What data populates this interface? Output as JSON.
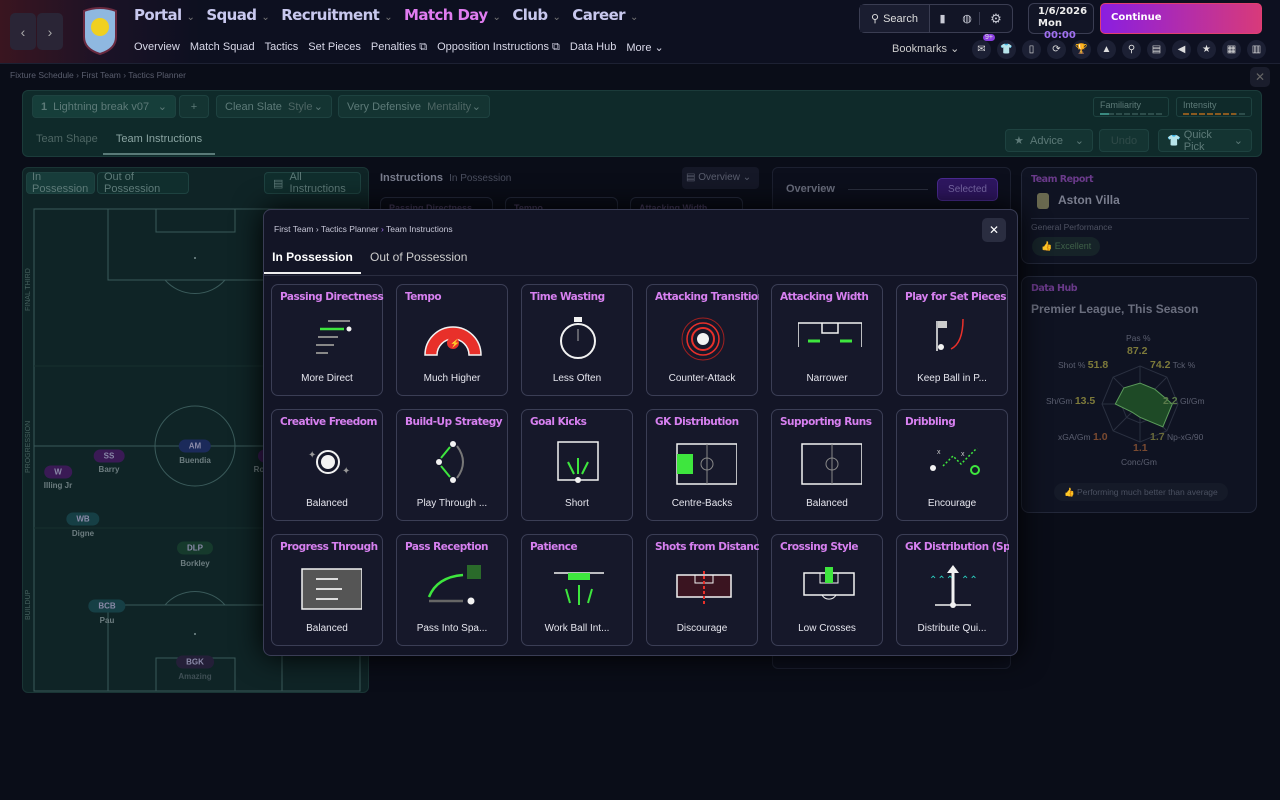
{
  "topbar": {
    "main_nav": [
      {
        "label": "Portal"
      },
      {
        "label": "Squad"
      },
      {
        "label": "Recruitment"
      },
      {
        "label": "Match Day",
        "active": true
      },
      {
        "label": "Club"
      },
      {
        "label": "Career"
      }
    ],
    "sub_nav": [
      "Overview",
      "Match Squad",
      "Tactics",
      "Set Pieces",
      "Penalties",
      "Opposition Instructions",
      "Data Hub",
      "More"
    ],
    "search_label": "Search",
    "date": "1/6/2026",
    "day": "Mon",
    "time": "00:00",
    "continue_label": "Continue",
    "bookmarks_label": "Bookmarks",
    "notification_badge": "9+"
  },
  "breadcrumb": [
    "Fixture Schedule",
    "First Team",
    "Tactics Planner"
  ],
  "tactic": {
    "number": "1",
    "name": "Lightning break v07",
    "style_value": "Clean Slate",
    "style_label": "Style",
    "mentality_value": "Very Defensive",
    "mentality_label": "Mentality",
    "familiarity_label": "Familiarity",
    "intensity_label": "Intensity",
    "familiarity_level": 0.15,
    "intensity_level": 0.85
  },
  "tabs": {
    "team_shape": "Team Shape",
    "team_instructions": "Team Instructions"
  },
  "actions": {
    "advice": "Advice",
    "undo": "Undo",
    "quick_pick": "Quick Pick"
  },
  "pitch": {
    "tabs": [
      "In Possession",
      "Out of Possession"
    ],
    "all_instructions": "All Instructions",
    "zones": [
      "FINAL THIRD",
      "PROGRESSION",
      "BUILDUP"
    ],
    "players": [
      {
        "role": "W",
        "name": "Illing Jr"
      },
      {
        "role": "SS",
        "name": "Barry"
      },
      {
        "role": "AM",
        "name": "Buendia"
      },
      {
        "role": "",
        "name": "Ro"
      },
      {
        "role": "WB",
        "name": "Digne"
      },
      {
        "role": "DLP",
        "name": "Borkley"
      },
      {
        "role": "BCB",
        "name": "Pau"
      },
      {
        "role": "BGK",
        "name": "Amazing"
      }
    ]
  },
  "instructions_panel": {
    "title": "Instructions",
    "subtitle": "In Possession",
    "view": "Overview",
    "bg_cards": [
      "Passing Directness",
      "Tempo",
      "Attacking Width"
    ]
  },
  "overview_panel": {
    "title": "Overview",
    "selected": "Selected"
  },
  "team_report": {
    "heading": "Team Report",
    "team": "Aston Villa",
    "perf_label": "General Performance",
    "perf_value": "Excellent"
  },
  "data_hub": {
    "heading": "Data Hub",
    "title": "Premier League, This Season",
    "footer": "Performing much better than average",
    "radar": [
      {
        "label": "Pas %",
        "value": "87.2"
      },
      {
        "label": "Tck %",
        "value": "74.2"
      },
      {
        "label": "Gl/Gm",
        "value": "2.2"
      },
      {
        "label": "Np-xG/90",
        "value": "1.7"
      },
      {
        "label": "Conc/Gm",
        "value": "1.1"
      },
      {
        "label": "xGA/Gm",
        "value": "1.0"
      },
      {
        "label": "Sh/Gm",
        "value": "13.5"
      },
      {
        "label": "Shot %",
        "value": "51.8"
      }
    ]
  },
  "modal": {
    "breadcrumb": [
      "First Team",
      "Tactics Planner",
      "Team Instructions"
    ],
    "tabs": [
      "In Possession",
      "Out of Possession"
    ],
    "cards": [
      {
        "title": "Passing Directness",
        "value": "More Direct",
        "icon": "passing-arrows"
      },
      {
        "title": "Tempo",
        "value": "Much Higher",
        "icon": "tempo-gauge"
      },
      {
        "title": "Time Wasting",
        "value": "Less Often",
        "icon": "stopwatch"
      },
      {
        "title": "Attacking Transition",
        "value": "Counter-Attack",
        "icon": "target-rings"
      },
      {
        "title": "Attacking Width",
        "value": "Narrower",
        "icon": "width-arrows"
      },
      {
        "title": "Play for Set Pieces",
        "value": "Keep Ball in P...",
        "icon": "corner-flag"
      },
      {
        "title": "Creative Freedom",
        "value": "Balanced",
        "icon": "sparkle-ball"
      },
      {
        "title": "Build-Up Strategy",
        "value": "Play Through ...",
        "icon": "build-up"
      },
      {
        "title": "Goal Kicks",
        "value": "Short",
        "icon": "goal-kick"
      },
      {
        "title": "GK Distribution",
        "value": "Centre-Backs",
        "icon": "pitch-zone"
      },
      {
        "title": "Supporting Runs",
        "value": "Balanced",
        "icon": "pitch"
      },
      {
        "title": "Dribbling",
        "value": "Encourage",
        "icon": "dribble"
      },
      {
        "title": "Progress Through",
        "value": "Balanced",
        "icon": "progress-pitch"
      },
      {
        "title": "Pass Reception",
        "value": "Pass Into Spa...",
        "icon": "pass-reception"
      },
      {
        "title": "Patience",
        "value": "Work Ball Int...",
        "icon": "patience"
      },
      {
        "title": "Shots from Distance",
        "value": "Discourage",
        "icon": "shots-box"
      },
      {
        "title": "Crossing Style",
        "value": "Low Crosses",
        "icon": "cross-box"
      },
      {
        "title": "GK Distribution (Speed",
        "value": "Distribute Qui...",
        "icon": "quick-distribute"
      }
    ]
  },
  "colors": {
    "accent": "#e07cf0",
    "continue_from": "#8a1ee0",
    "continue_to": "#d83a7a",
    "green": "#3ee63e",
    "red": "#e8302a"
  }
}
